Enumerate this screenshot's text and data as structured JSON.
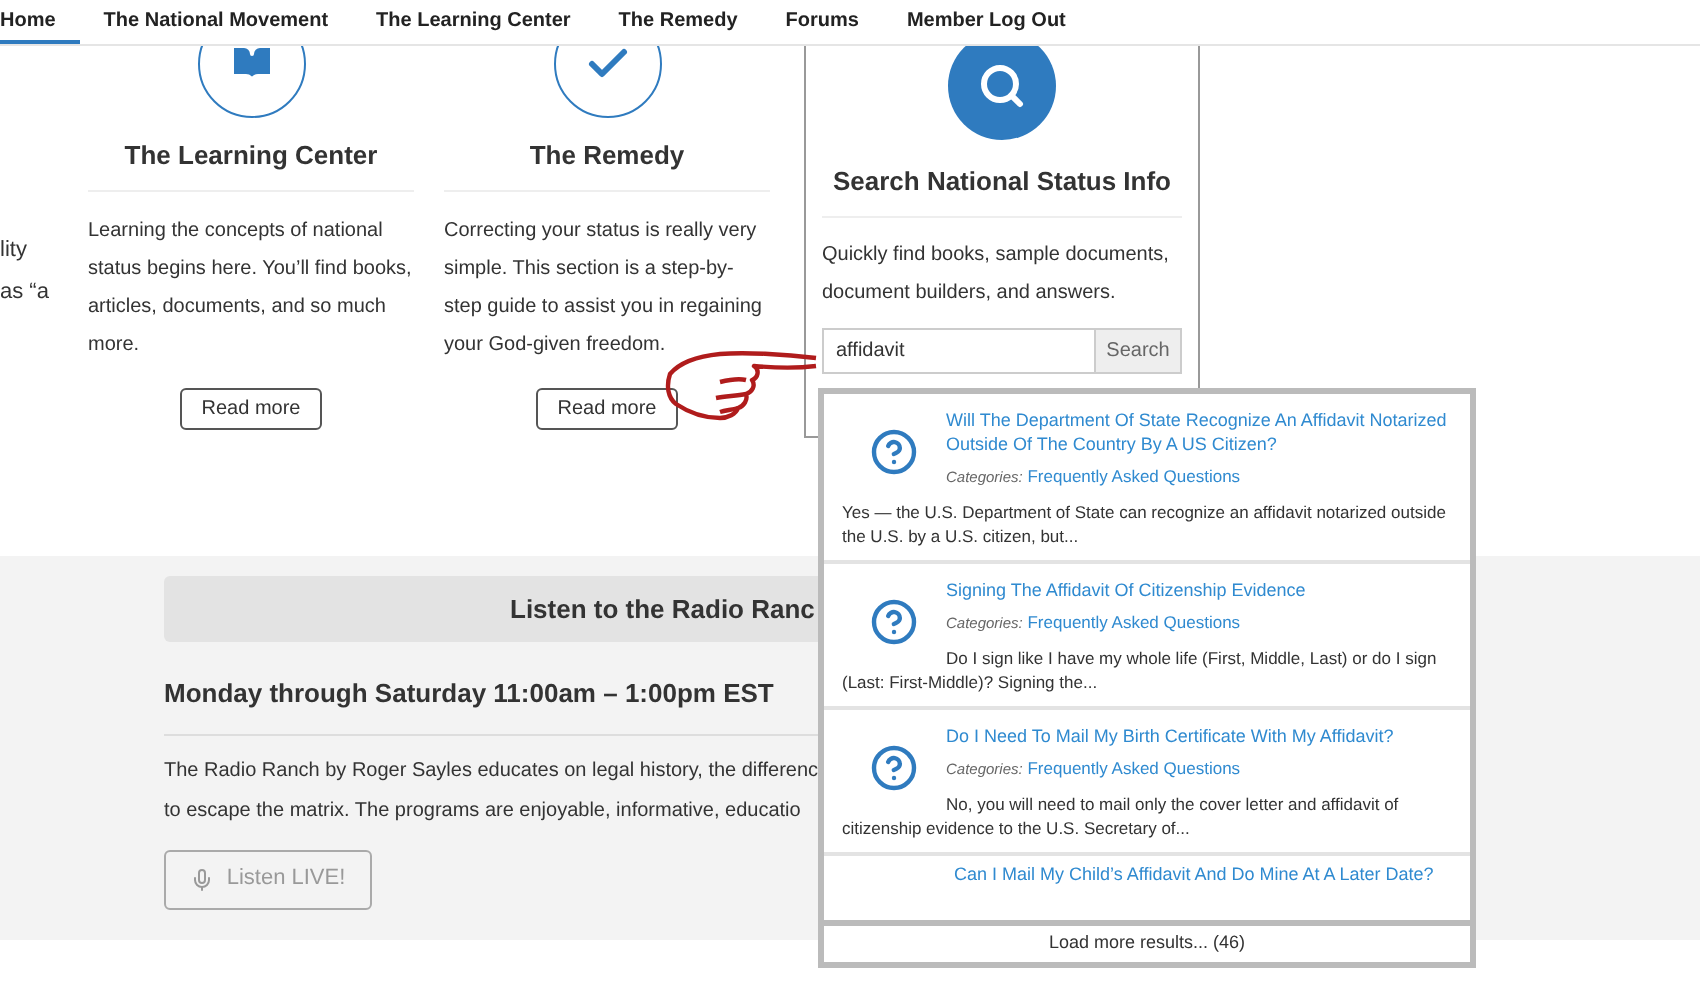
{
  "nav": [
    {
      "label": "Home",
      "selected": true
    },
    {
      "label": "The National Movement",
      "selected": false
    },
    {
      "label": "The Learning Center",
      "selected": false
    },
    {
      "label": "The Remedy",
      "selected": false
    },
    {
      "label": "Forums",
      "selected": false
    },
    {
      "label": "Member Log Out",
      "selected": false
    }
  ],
  "partial_column": {
    "lines": [
      "lity",
      "as “a"
    ]
  },
  "features": [
    {
      "kind": "book",
      "title": "The Learning Center",
      "text": "Learning the concepts of national status begins here. You’ll find books, articles, documents, and so much more.",
      "button": "Read more"
    },
    {
      "kind": "check",
      "title": "The Remedy",
      "text": "Correcting your status is really very simple. This section is a step-by-step guide to assist you in regaining your God-given freedom.",
      "button": "Read more"
    }
  ],
  "search_panel": {
    "title": "Search National Status Info",
    "text": "Quickly find books, sample documents, document builders, and answers.",
    "input": {
      "value": "affidavit"
    },
    "button": "Search"
  },
  "results": {
    "items": [
      {
        "title": "Will The Department Of State Recognize An Affidavit Notarized Outside Of The Country By A US Citizen?",
        "category_label": "Categories:",
        "category": "Frequently Asked Questions",
        "excerpt": "Yes — the U.S. Department of State can recognize an affidavit notarized outside the U.S. by a U.S. citizen, but..."
      },
      {
        "title": "Signing The Affidavit Of Citizenship Evidence",
        "category_label": "Categories:",
        "category": "Frequently Asked Questions",
        "excerpt": "Do I sign like I have my whole life (First, Middle, Last) or do I sign (Last: First-Middle)? Signing the..."
      },
      {
        "title": "Do I Need To Mail My Birth Certificate With My Affidavit?",
        "category_label": "Categories:",
        "category": "Frequently Asked Questions",
        "excerpt": "No, you will need to mail only the cover letter and affidavit of citizenship evidence to the U.S. Secretary of..."
      }
    ],
    "partial_item_title": "Can I Mail My Child’s Affidavit And Do Mine At A Later Date?",
    "load_more": "Load more results... (46)"
  },
  "radio": {
    "heading": "Listen to the Radio Ranc",
    "schedule": "Monday through Saturday 11:00am – 1:00pm EST",
    "lines": [
      "The Radio Ranch by Roger Sayles educates on legal history, the differenc",
      "to escape the matrix. The programs are enjoyable, informative, educatio"
    ],
    "button": "Listen LIVE!"
  }
}
